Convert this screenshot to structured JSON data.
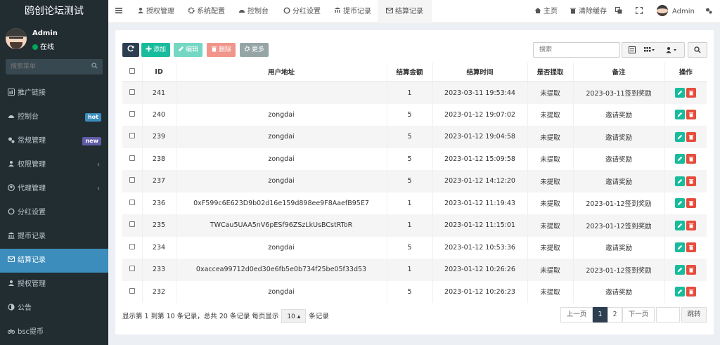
{
  "sidebar": {
    "brand": "鸥创论坛测试",
    "user": {
      "name": "Admin",
      "status": "在线"
    },
    "search_placeholder": "搜索菜单",
    "items": [
      {
        "label": "推广链接",
        "icon": "bar-chart-icon"
      },
      {
        "label": "控制台",
        "icon": "dashboard-icon",
        "badge": "hot"
      },
      {
        "label": "常规管理",
        "icon": "cogs-icon",
        "badge": "new"
      },
      {
        "label": "权限管理",
        "icon": "group-icon",
        "chevron": "‹"
      },
      {
        "label": "代理管理",
        "icon": "user-circle-icon",
        "chevron": "‹"
      },
      {
        "label": "分红设置",
        "icon": "circle-icon"
      },
      {
        "label": "提币记录",
        "icon": "bank-icon"
      },
      {
        "label": "结算记录",
        "icon": "envelope-icon",
        "active": true
      },
      {
        "label": "授权管理",
        "icon": "group-icon"
      },
      {
        "label": "公告",
        "icon": "adjust-icon"
      },
      {
        "label": "bsc提币",
        "icon": "bicycle-icon"
      }
    ]
  },
  "topnav": {
    "tabs": [
      "授权管理",
      "系统配置",
      "控制台",
      "分红设置",
      "提币记录",
      "结算记录"
    ],
    "right": {
      "home": "主页",
      "clear_cache": "清除缓存",
      "user": "Admin"
    }
  },
  "toolbar": {
    "add": "添加",
    "edit": "编辑",
    "delete": "删除",
    "more": "更多",
    "search_placeholder": "搜索"
  },
  "table": {
    "headers": [
      "ID",
      "用户地址",
      "结算金额",
      "结算时间",
      "是否提取",
      "备注",
      "操作"
    ],
    "rows": [
      {
        "id": "241",
        "address": "",
        "amount": "1",
        "time": "2023-03-11 19:53:44",
        "withdrawn": "未提取",
        "note": "2023-03-11签到奖励"
      },
      {
        "id": "240",
        "address": "zongdai",
        "amount": "5",
        "time": "2023-01-12 19:07:02",
        "withdrawn": "未提取",
        "note": "邀请奖励"
      },
      {
        "id": "239",
        "address": "zongdai",
        "amount": "5",
        "time": "2023-01-12 19:04:58",
        "withdrawn": "未提取",
        "note": "邀请奖励"
      },
      {
        "id": "238",
        "address": "zongdai",
        "amount": "5",
        "time": "2023-01-12 15:09:58",
        "withdrawn": "未提取",
        "note": "邀请奖励"
      },
      {
        "id": "237",
        "address": "zongdai",
        "amount": "5",
        "time": "2023-01-12 14:12:20",
        "withdrawn": "未提取",
        "note": "邀请奖励"
      },
      {
        "id": "236",
        "address": "0xF599c6E623D9b02d16e159d898ee9F8AaefB95E7",
        "amount": "1",
        "time": "2023-01-12 11:19:43",
        "withdrawn": "未提取",
        "note": "2023-01-12签到奖励"
      },
      {
        "id": "235",
        "address": "TWCau5UAA5nV6pESf96ZSzLkUsBCstRToR",
        "amount": "1",
        "time": "2023-01-12 11:15:01",
        "withdrawn": "未提取",
        "note": "2023-01-12签到奖励"
      },
      {
        "id": "234",
        "address": "zongdai",
        "amount": "5",
        "time": "2023-01-12 10:53:36",
        "withdrawn": "未提取",
        "note": "邀请奖励"
      },
      {
        "id": "233",
        "address": "0xaccea99712d0ed30e6fb5e0b734f25be05f33d53",
        "amount": "1",
        "time": "2023-01-12 10:26:26",
        "withdrawn": "未提取",
        "note": "2023-01-12签到奖励"
      },
      {
        "id": "232",
        "address": "zongdai",
        "amount": "5",
        "time": "2023-01-12 10:26:23",
        "withdrawn": "未提取",
        "note": "邀请奖励"
      }
    ]
  },
  "footer": {
    "info_prefix": "显示第 1 到第 10 条记录，总共 20 条记录 每页显示",
    "page_size": "10",
    "info_suffix": "条记录",
    "prev": "上一页",
    "pages": [
      "1",
      "2"
    ],
    "next": "下一页",
    "jump": "跳转"
  },
  "colors": {
    "sidebar_bg": "#222d32",
    "active": "#3c8dbc",
    "add": "#18bc9c",
    "delete": "#e74c3c",
    "more": "#95a5a6"
  }
}
